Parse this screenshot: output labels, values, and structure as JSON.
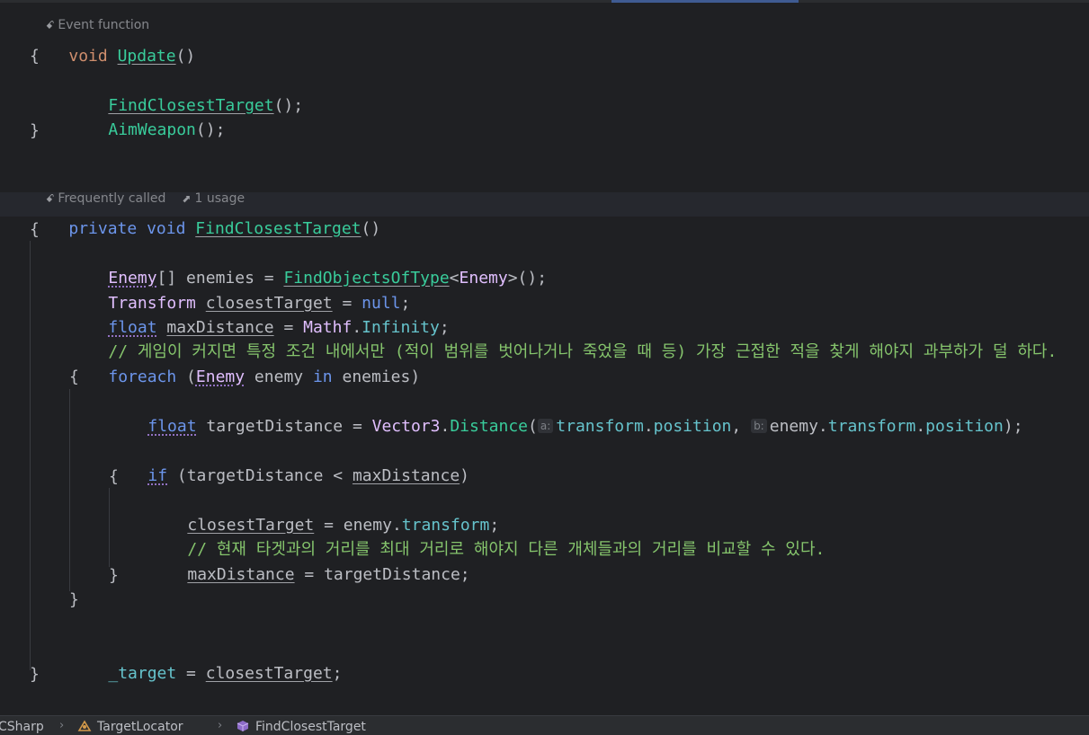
{
  "hints": {
    "event_function": "Event function",
    "frequently_called": "Frequently called",
    "usages": "1 usage"
  },
  "inlay_hints": {
    "a": "a:",
    "b": "b:"
  },
  "code": {
    "l1_void": "void",
    "l1_name": "Update",
    "l1_rest": "()",
    "brace_open": "{",
    "brace_close": "}",
    "l3_call": "FindClosestTarget",
    "l3_rest": "();",
    "l4_call": "AimWeapon",
    "l4_rest": "();",
    "l7_private": "private",
    "l7_void": "void",
    "l7_name": "FindClosestTarget",
    "l7_rest": "()",
    "l9_type": "Enemy",
    "l9_a": "[] enemies = ",
    "l9_fn": "FindObjectsOfType",
    "l9_lt": "<",
    "l9_gen": "Enemy",
    "l9_end": ">();",
    "l10_type": "Transform",
    "l10_var": "closestTarget",
    "l10_eq": " = ",
    "l10_null": "null",
    "l10_end": ";",
    "l11_float": "float",
    "l11_var": "maxDistance",
    "l11_eq": " = ",
    "l11_cls": "Mathf",
    "l11_dot": ".",
    "l11_prop": "Infinity",
    "l11_end": ";",
    "l12_comment": "// 게임이 커지면 특정 조건 내에서만 (적이 범위를 벗어나거나 죽었을 때 등) 가장 근접한 적을 찾게 해야지 과부하가 덜 하다.",
    "l13_foreach": "foreach",
    "l13_open": " (",
    "l13_type": "Enemy",
    "l13_var": " enemy ",
    "l13_in": "in",
    "l13_rest": " enemies)",
    "l15_float": "float",
    "l15_a": " targetDistance = ",
    "l15_cls": "Vector3",
    "l15_dot": ".",
    "l15_meth": "Distance",
    "l15_paren": "(",
    "l15_arg1a": "transform",
    "l15_dot2": ".",
    "l15_arg1b": "position",
    "l15_comma": ", ",
    "l15_arg2a": "enemy.",
    "l15_arg2b": "transform",
    "l15_dot3": ".",
    "l15_arg2c": "position",
    "l15_end": ");",
    "l17_if": "if",
    "l17_a": " (targetDistance < ",
    "l17_var": "maxDistance",
    "l17_end": ")",
    "l19_var": "closestTarget",
    "l19_a": " = enemy.",
    "l19_prop": "transform",
    "l19_end": ";",
    "l20_comment": "// 현재 타겟과의 거리를 최대 거리로 해야지 다른 개체들과의 거리를 비교할 수 있다.",
    "l21_var": "maxDistance",
    "l21_rest": " = targetDistance;",
    "l25_fld": "_target",
    "l25_eq": " = ",
    "l25_var": "closestTarget",
    "l25_end": ";"
  },
  "breadcrumb": {
    "project": "CSharp",
    "class": "TargetLocator",
    "method": "FindClosestTarget"
  }
}
